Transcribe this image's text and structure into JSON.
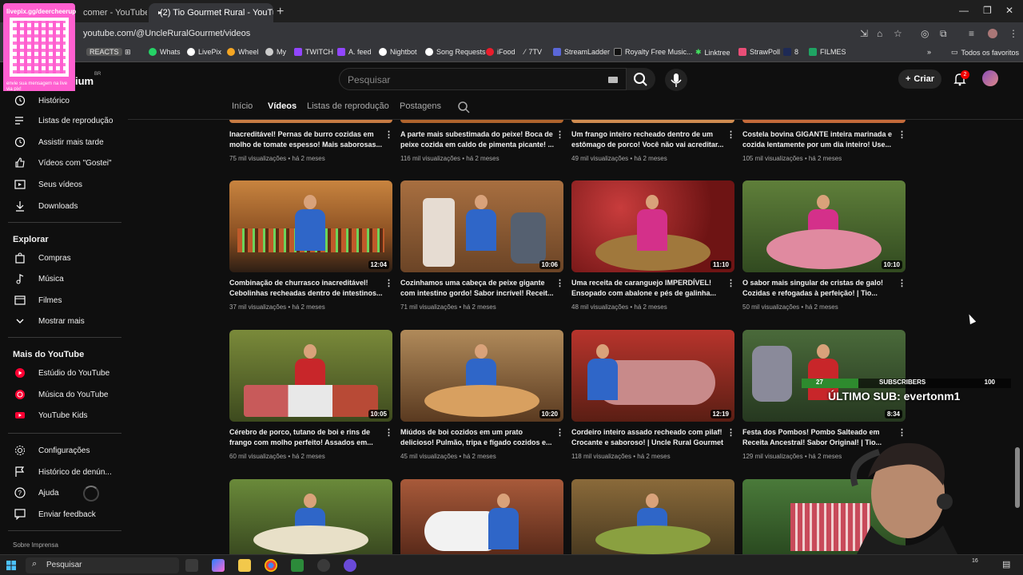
{
  "browser": {
    "tabs": [
      {
        "label": "comer - YouTube"
      },
      {
        "label": "(2) Tio Gourmet Rural - YouTub"
      }
    ],
    "url": "youtube.com/@UncleRuralGourmet/videos",
    "bookmarks": [
      "REACTS",
      "Whats",
      "LivePix",
      "Wheel",
      "My",
      "TWITCH",
      "A. feed",
      "Nightbot",
      "Song Requests",
      "iFood",
      "7TV",
      "StreamLadder",
      "Royalty Free Music...",
      "Linktree",
      "StrawPoll",
      "8",
      "FILMES"
    ],
    "favorites_label": "Todos os favoritos"
  },
  "qr_overlay": {
    "top": "livepix.gg/deercheerup",
    "bottom": "envie sua mensagem na live via pix!"
  },
  "yt": {
    "logo_fragment": "ium",
    "logo_region": "BR",
    "search_placeholder": "Pesquisar",
    "create_label": "Criar",
    "notifications": "2"
  },
  "sidebar": {
    "items_top": [
      "Histórico",
      "Listas de reprodução",
      "Assistir mais tarde",
      "Vídeos com \"Gostei\"",
      "Seus vídeos",
      "Downloads"
    ],
    "explore_heading": "Explorar",
    "explore": [
      "Compras",
      "Música",
      "Filmes",
      "Mostrar mais"
    ],
    "more_heading": "Mais do YouTube",
    "more": [
      "Estúdio do YouTube",
      "Música do YouTube",
      "YouTube Kids"
    ],
    "settings": [
      "Configurações",
      "Histórico de denún...",
      "Ajuda",
      "Enviar feedback"
    ],
    "footer": "Sobre   Imprensa"
  },
  "channel_tabs": [
    "Início",
    "Vídeos",
    "Listas de reprodução",
    "Postagens"
  ],
  "videos_row0": [
    {
      "title": "Inacreditável! Pernas de burro cozidas em molho de tomate espesso! Mais saborosas...",
      "meta": "75 mil visualizações • há 2 meses"
    },
    {
      "title": "A parte mais subestimada do peixe! Boca de peixe cozida em caldo de pimenta picante! ...",
      "meta": "116 mil visualizações • há 2 meses"
    },
    {
      "title": "Um frango inteiro recheado dentro de um estômago de porco! Você não vai acreditar...",
      "meta": "49 mil visualizações • há 2 meses"
    },
    {
      "title": "Costela bovina GIGANTE inteira marinada e cozida lentamente por um dia inteiro! Use...",
      "meta": "105 mil visualizações • há 2 meses"
    }
  ],
  "videos_row1": [
    {
      "title": "Combinação de churrasco inacreditável! Cebolinhas recheadas dentro de intestinos...",
      "meta": "37 mil visualizações • há 2 meses",
      "duration": "12:04"
    },
    {
      "title": "Cozinhamos uma cabeça de peixe gigante com intestino gordo! Sabor incrível! Receit...",
      "meta": "71 mil visualizações • há 2 meses",
      "duration": "10:06"
    },
    {
      "title": "Uma receita de caranguejo IMPERDÍVEL! Ensopado com abalone e pés de galinha...",
      "meta": "48 mil visualizações • há 2 meses",
      "duration": "11:10"
    },
    {
      "title": "O sabor mais singular de cristas de galo! Cozidas e refogadas à perfeição! | Tio...",
      "meta": "50 mil visualizações • há 2 meses",
      "duration": "10:10"
    }
  ],
  "videos_row2": [
    {
      "title": "Cérebro de porco, tutano de boi e rins de frango com molho perfeito! Assados em...",
      "meta": "60 mil visualizações • há 2 meses",
      "duration": "10:05"
    },
    {
      "title": "Miúdos de boi cozidos em um prato delicioso! Pulmão, tripa e fígado cozidos e...",
      "meta": "45 mil visualizações • há 2 meses",
      "duration": "10:20"
    },
    {
      "title": "Cordeiro inteiro assado recheado com pilaf! Crocante e saboroso! | Uncle Rural Gourmet",
      "meta": "118 mil visualizações • há 2 meses",
      "duration": "12:19"
    },
    {
      "title": "Festa dos Pombos! Pombo Salteado em Receita Ancestral! Sabor Original! | Tio...",
      "meta": "129 mil visualizações • há 2 meses",
      "duration": "8:34"
    }
  ],
  "stream": {
    "sub_count": "27",
    "sub_label": "SUBSCRIBERS",
    "sub_goal": "100",
    "sub_progress": 0.27,
    "last_sub": "ÚLTIMO SUB: evertonm1"
  },
  "taskbar": {
    "search": "Pesquisar",
    "clock": "16"
  }
}
